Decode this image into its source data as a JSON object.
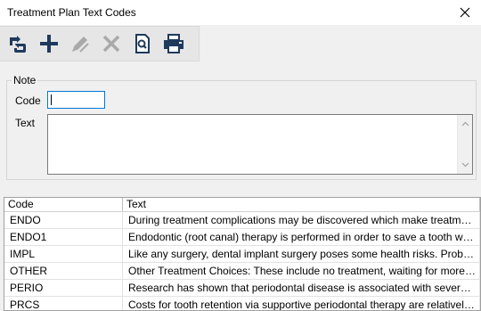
{
  "window": {
    "title": "Treatment Plan Text Codes",
    "close_glyph": "✕"
  },
  "toolbar": {
    "buttons": [
      {
        "name": "refresh-icon",
        "enabled": true
      },
      {
        "name": "add-icon",
        "enabled": true
      },
      {
        "name": "edit-icon",
        "enabled": false
      },
      {
        "name": "delete-icon",
        "enabled": false
      },
      {
        "name": "preview-icon",
        "enabled": true
      },
      {
        "name": "print-icon",
        "enabled": true
      }
    ]
  },
  "note": {
    "legend": "Note",
    "code_label": "Code",
    "text_label": "Text",
    "code_value": "",
    "text_value": ""
  },
  "grid": {
    "columns": [
      "Code",
      "Text"
    ],
    "rows": [
      {
        "code": "ENDO",
        "text": " During treatment complications may be discovered which make treatment impo..."
      },
      {
        "code": "ENDO1",
        "text": "Endodontic (root canal) therapy is performed in order to save a tooth which migh..."
      },
      {
        "code": "IMPL",
        "text": "Like any surgery, dental implant surgery poses some health risks. Problems are r..."
      },
      {
        "code": "OTHER",
        "text": "Other Treatment Choices: These include no treatment, waiting for more definite ..."
      },
      {
        "code": "PERIO",
        "text": "Research has shown that periodontal disease is associated with several other di..."
      },
      {
        "code": "PRCS",
        "text": "Costs for tooth retention via supportive periodontal therapy are relatively low co..."
      }
    ]
  },
  "colors": {
    "accent": "#0078d7",
    "toolbar_icon": "#1f3a5c",
    "disabled_icon": "#a9a9a9"
  }
}
